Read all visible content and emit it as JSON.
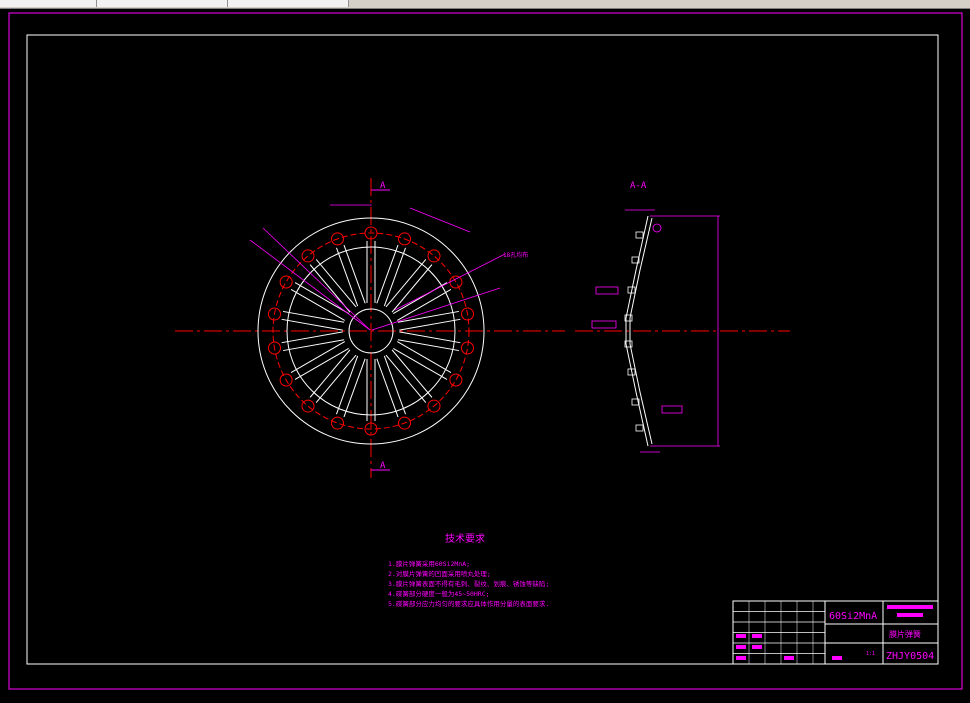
{
  "section_label_top": "A",
  "section_label_bottom": "A",
  "section_view_title": "A-A",
  "annotation_holes": "18孔均布",
  "tech_title": "技术要求",
  "tech_lines": [
    "1.膜片弹簧采用60Si2MnA;",
    "2.对膜片弹簧的凹面采用喷丸处理;",
    "3.膜片弹簧表面不得有毛刺、裂纹、划痕、锈蚀等缺陷;",
    "4.碟簧部分硬度一般为45~50HRC;",
    "5.碟簧部分应力均匀的要求应具体作用分量的表面要求."
  ],
  "title_block": {
    "material": "60Si2MnA",
    "part_name": "膜片弹簧",
    "drawing_no": "ZHJY0504",
    "scale": "1:1"
  },
  "colors": {
    "frame": "#ff00ff",
    "drawing": "#ffffff",
    "center_line": "#ff0000",
    "dimension": "#ff00ff",
    "background": "#000000"
  }
}
